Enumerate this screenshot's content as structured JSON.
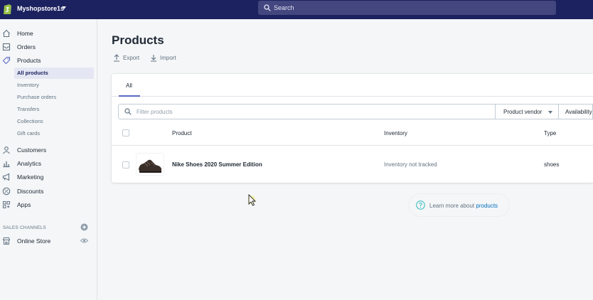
{
  "topbar": {
    "store_name": "Myshopstore1s",
    "search_placeholder": "Search"
  },
  "sidebar": {
    "nav": {
      "home": "Home",
      "orders": "Orders",
      "products": "Products",
      "customers": "Customers",
      "analytics": "Analytics",
      "marketing": "Marketing",
      "discounts": "Discounts",
      "apps": "Apps"
    },
    "sub": {
      "all_products": "All products",
      "inventory": "Inventory",
      "purchase_orders": "Purchase orders",
      "transfers": "Transfers",
      "collections": "Collections",
      "gift_cards": "Gift cards"
    },
    "sales_channels_title": "SALES CHANNELS",
    "online_store": "Online Store"
  },
  "main": {
    "title": "Products",
    "export_label": "Export",
    "import_label": "Import",
    "tab_all": "All",
    "filter_placeholder": "Filter products",
    "vendor_label": "Product vendor",
    "availability_label": "Availability",
    "columns": {
      "product": "Product",
      "inventory": "Inventory",
      "type": "Type"
    },
    "rows": [
      {
        "name": "Nike Shoes 2020 Summer Edition",
        "inventory": "Inventory not tracked",
        "type": "shoes"
      }
    ],
    "learn_text": "Learn more about ",
    "learn_link": "products"
  },
  "colors": {
    "topbar": "#1c2260",
    "accent": "#5c6ac4",
    "link": "#006fbb"
  }
}
